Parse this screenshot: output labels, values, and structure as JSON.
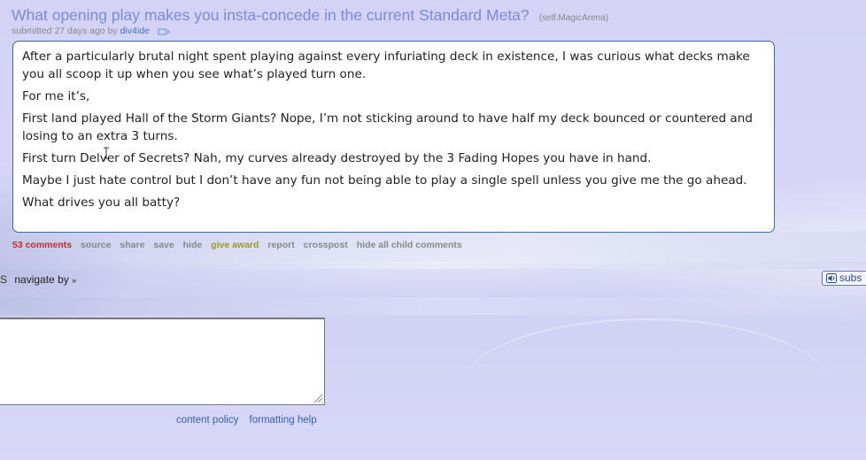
{
  "post": {
    "title": "What opening play makes you insta-concede in the current Standard Meta?",
    "domain": "(self.MagicArena)",
    "submitted_prefix": "submitted 27 days ago by",
    "author": "div4ide",
    "body": [
      "After a particularly brutal night spent playing against every infuriating deck in existence, I was curious what decks make you all scoop it up when you see what’s played turn one.",
      "For me it’s,",
      "First land played Hall of the Storm Giants? Nope, I’m not sticking around to have half my deck bounced or countered and losing to an extra 3 turns.",
      "First turn Delver of Secrets? Nah, my curves already destroyed by the 3 Fading Hopes you have in hand.",
      "Maybe I just hate control but I don’t have any fun not being able to play a single spell unless you give me the go ahead.",
      "What drives you all batty?"
    ]
  },
  "buttons": {
    "comments": "53 comments",
    "source": "source",
    "share": "share",
    "save": "save",
    "hide": "hide",
    "give_award": "give award",
    "report": "report",
    "crosspost": "crosspost",
    "hide_child": "hide all child comments"
  },
  "navigate": {
    "left_glyph": "S",
    "label": "navigate by",
    "arrow": "»"
  },
  "subscribe": {
    "label": "subs"
  },
  "comment_box": {
    "value": ""
  },
  "footer": {
    "content_policy": "content policy",
    "formatting_help": "formatting help"
  },
  "colors": {
    "title_link": "#7a8ad6",
    "comments_link": "#c32d2d",
    "give_award": "#9a9a20",
    "author_link": "#4a6fb5",
    "selftext_border": "#3b6aa5",
    "page_background": "#d2d2f4"
  },
  "icons": {
    "tag_icon": "tag-icon",
    "speaker_icon": "speaker-icon",
    "resize_grip_icon": "resize-grip-icon",
    "text_cursor_icon": "text-cursor-icon"
  }
}
